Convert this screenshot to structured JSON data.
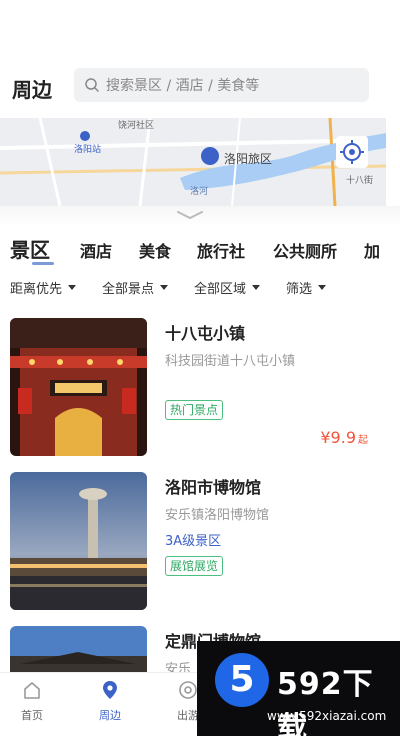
{
  "header": {
    "title": "周边",
    "search_placeholder": "搜索景区 / 酒店 / 美食等"
  },
  "map": {
    "labels": {
      "station": "洛阳站",
      "district": "洛阳旅区",
      "road": "洛河",
      "north": "十八街",
      "community": "饶河社区"
    }
  },
  "tabs": [
    "景区",
    "酒店",
    "美食",
    "旅行社",
    "公共厕所",
    "加"
  ],
  "filters": [
    "距离优先",
    "全部景点",
    "全部区域",
    "筛选"
  ],
  "cards": [
    {
      "name": "十八屯小镇",
      "address": "科技园街道十八屯小镇",
      "tag": "热门景点",
      "price": "¥9.9",
      "price_suffix": "起"
    },
    {
      "name": "洛阳市博物馆",
      "address": "安乐镇洛阳博物馆",
      "level": "3A级景区",
      "tag": "展馆展览"
    },
    {
      "name": "定鼎门博物馆",
      "address": "安乐"
    }
  ],
  "tabbar": [
    {
      "label": "首页",
      "icon": "home-icon"
    },
    {
      "label": "周边",
      "icon": "location-icon",
      "active": true
    },
    {
      "label": "出游",
      "icon": "compass-icon"
    }
  ],
  "watermark": {
    "logo_digit": "5",
    "brand": "592下载",
    "url": "www.592xiazai.com"
  },
  "colors": {
    "accent": "#3c62c8",
    "price": "#f0543c",
    "tag": "#2fa864"
  }
}
